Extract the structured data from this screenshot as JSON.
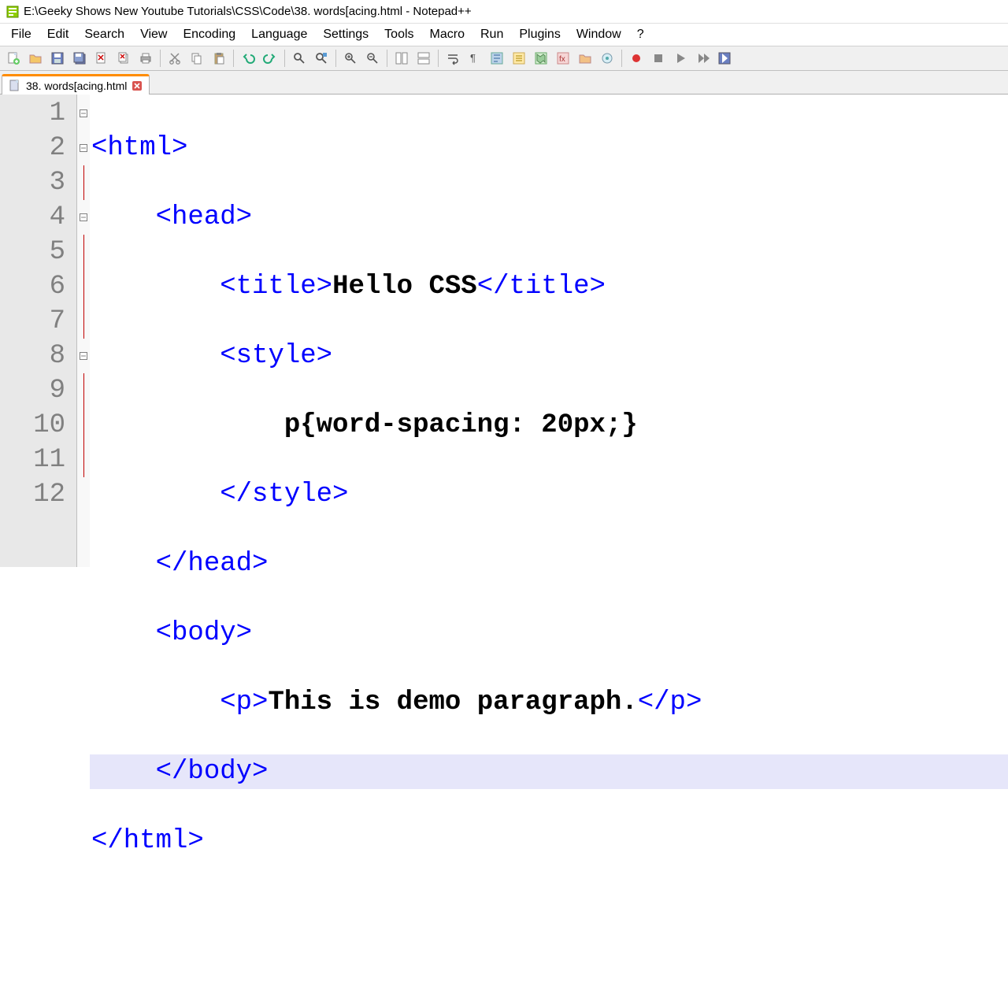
{
  "window": {
    "title": "E:\\Geeky Shows New Youtube Tutorials\\CSS\\Code\\38. words[acing.html - Notepad++"
  },
  "menu": {
    "items": [
      "File",
      "Edit",
      "Search",
      "View",
      "Encoding",
      "Language",
      "Settings",
      "Tools",
      "Macro",
      "Run",
      "Plugins",
      "Window",
      "?"
    ]
  },
  "tab": {
    "label": "38. words[acing.html"
  },
  "gutter": {
    "lines": [
      "1",
      "2",
      "3",
      "4",
      "5",
      "6",
      "7",
      "8",
      "9",
      "10",
      "11",
      "12"
    ]
  },
  "code": {
    "l1_tag": "<html>",
    "l2_tag": "<head>",
    "l3_open": "<title>",
    "l3_text": "Hello CSS",
    "l3_close": "</title>",
    "l4_tag": "<style>",
    "l5_css": "p{word-spacing: 20px;}",
    "l6_tag": "</style>",
    "l7_tag": "</head>",
    "l8_tag": "<body>",
    "l9_open": "<p>",
    "l9_text": "This is demo paragraph.",
    "l9_close": "</p>",
    "l10_tag": "</body>",
    "l11_tag": "</html>"
  }
}
